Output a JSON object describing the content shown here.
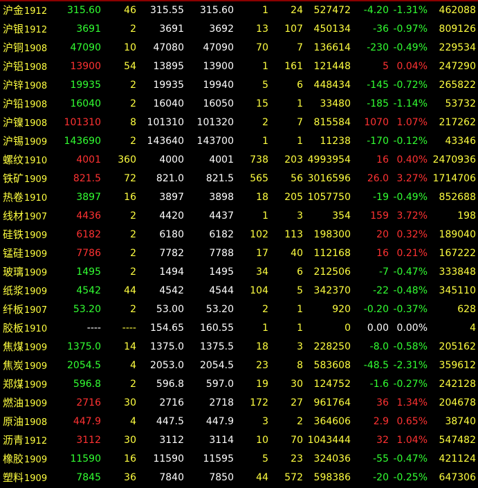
{
  "quotes": [
    {
      "name": "沪金",
      "code": "1912",
      "last": "315.60",
      "last_vol": "46",
      "bid": "315.55",
      "ask": "315.60",
      "bid_vol": "1",
      "ask_vol": "24",
      "volume": "527472",
      "change": "-4.20",
      "pct": "-1.31%",
      "open_interest": "462088",
      "dir": "down"
    },
    {
      "name": "沪银",
      "code": "1912",
      "last": "3691",
      "last_vol": "2",
      "bid": "3691",
      "ask": "3692",
      "bid_vol": "13",
      "ask_vol": "107",
      "volume": "450134",
      "change": "-36",
      "pct": "-0.97%",
      "open_interest": "809126",
      "dir": "down"
    },
    {
      "name": "沪铜",
      "code": "1908",
      "last": "47090",
      "last_vol": "10",
      "bid": "47080",
      "ask": "47090",
      "bid_vol": "70",
      "ask_vol": "7",
      "volume": "136614",
      "change": "-230",
      "pct": "-0.49%",
      "open_interest": "229534",
      "dir": "down"
    },
    {
      "name": "沪铝",
      "code": "1908",
      "last": "13900",
      "last_vol": "54",
      "bid": "13895",
      "ask": "13900",
      "bid_vol": "1",
      "ask_vol": "161",
      "volume": "121448",
      "change": "5",
      "pct": "0.04%",
      "open_interest": "247290",
      "dir": "up"
    },
    {
      "name": "沪锌",
      "code": "1908",
      "last": "19935",
      "last_vol": "2",
      "bid": "19935",
      "ask": "19940",
      "bid_vol": "5",
      "ask_vol": "6",
      "volume": "448434",
      "change": "-145",
      "pct": "-0.72%",
      "open_interest": "265822",
      "dir": "down"
    },
    {
      "name": "沪铅",
      "code": "1908",
      "last": "16040",
      "last_vol": "2",
      "bid": "16040",
      "ask": "16050",
      "bid_vol": "15",
      "ask_vol": "1",
      "volume": "33480",
      "change": "-185",
      "pct": "-1.14%",
      "open_interest": "53732",
      "dir": "down"
    },
    {
      "name": "沪镍",
      "code": "1908",
      "last": "101310",
      "last_vol": "8",
      "bid": "101310",
      "ask": "101320",
      "bid_vol": "2",
      "ask_vol": "7",
      "volume": "815584",
      "change": "1070",
      "pct": "1.07%",
      "open_interest": "217262",
      "dir": "up"
    },
    {
      "name": "沪锡",
      "code": "1909",
      "last": "143690",
      "last_vol": "2",
      "bid": "143640",
      "ask": "143700",
      "bid_vol": "1",
      "ask_vol": "1",
      "volume": "11238",
      "change": "-170",
      "pct": "-0.12%",
      "open_interest": "43346",
      "dir": "down"
    },
    {
      "name": "螺纹",
      "code": "1910",
      "last": "4001",
      "last_vol": "360",
      "bid": "4000",
      "ask": "4001",
      "bid_vol": "738",
      "ask_vol": "203",
      "volume": "4993954",
      "change": "16",
      "pct": "0.40%",
      "open_interest": "2470936",
      "dir": "up"
    },
    {
      "name": "铁矿",
      "code": "1909",
      "last": "821.5",
      "last_vol": "72",
      "bid": "821.0",
      "ask": "821.5",
      "bid_vol": "565",
      "ask_vol": "56",
      "volume": "3016596",
      "change": "26.0",
      "pct": "3.27%",
      "open_interest": "1714706",
      "dir": "up"
    },
    {
      "name": "热卷",
      "code": "1910",
      "last": "3897",
      "last_vol": "16",
      "bid": "3897",
      "ask": "3898",
      "bid_vol": "18",
      "ask_vol": "205",
      "volume": "1057750",
      "change": "-19",
      "pct": "-0.49%",
      "open_interest": "852688",
      "dir": "down"
    },
    {
      "name": "线材",
      "code": "1907",
      "last": "4436",
      "last_vol": "2",
      "bid": "4420",
      "ask": "4437",
      "bid_vol": "1",
      "ask_vol": "3",
      "volume": "354",
      "change": "159",
      "pct": "3.72%",
      "open_interest": "198",
      "dir": "up"
    },
    {
      "name": "硅铁",
      "code": "1909",
      "last": "6182",
      "last_vol": "2",
      "bid": "6180",
      "ask": "6182",
      "bid_vol": "102",
      "ask_vol": "113",
      "volume": "198300",
      "change": "20",
      "pct": "0.32%",
      "open_interest": "189040",
      "dir": "up"
    },
    {
      "name": "锰硅",
      "code": "1909",
      "last": "7786",
      "last_vol": "2",
      "bid": "7782",
      "ask": "7788",
      "bid_vol": "17",
      "ask_vol": "40",
      "volume": "112168",
      "change": "16",
      "pct": "0.21%",
      "open_interest": "167222",
      "dir": "up"
    },
    {
      "name": "玻璃",
      "code": "1909",
      "last": "1495",
      "last_vol": "2",
      "bid": "1494",
      "ask": "1495",
      "bid_vol": "34",
      "ask_vol": "6",
      "volume": "212506",
      "change": "-7",
      "pct": "-0.47%",
      "open_interest": "333848",
      "dir": "down"
    },
    {
      "name": "纸浆",
      "code": "1909",
      "last": "4542",
      "last_vol": "44",
      "bid": "4542",
      "ask": "4544",
      "bid_vol": "104",
      "ask_vol": "5",
      "volume": "342370",
      "change": "-22",
      "pct": "-0.48%",
      "open_interest": "345110",
      "dir": "down"
    },
    {
      "name": "纤板",
      "code": "1907",
      "last": "53.20",
      "last_vol": "2",
      "bid": "53.00",
      "ask": "53.20",
      "bid_vol": "2",
      "ask_vol": "1",
      "volume": "920",
      "change": "-0.20",
      "pct": "-0.37%",
      "open_interest": "628",
      "dir": "down"
    },
    {
      "name": "胶板",
      "code": "1910",
      "last": "----",
      "last_vol": "----",
      "bid": "154.65",
      "ask": "160.55",
      "bid_vol": "1",
      "ask_vol": "1",
      "volume": "0",
      "change": "0.00",
      "pct": "0.00%",
      "open_interest": "4",
      "dir": "flat"
    },
    {
      "name": "焦煤",
      "code": "1909",
      "last": "1375.0",
      "last_vol": "14",
      "bid": "1375.0",
      "ask": "1375.5",
      "bid_vol": "18",
      "ask_vol": "3",
      "volume": "228250",
      "change": "-8.0",
      "pct": "-0.58%",
      "open_interest": "205162",
      "dir": "down"
    },
    {
      "name": "焦炭",
      "code": "1909",
      "last": "2054.5",
      "last_vol": "4",
      "bid": "2053.0",
      "ask": "2054.5",
      "bid_vol": "23",
      "ask_vol": "8",
      "volume": "583608",
      "change": "-48.5",
      "pct": "-2.31%",
      "open_interest": "359612",
      "dir": "down"
    },
    {
      "name": "郑煤",
      "code": "1909",
      "last": "596.8",
      "last_vol": "2",
      "bid": "596.8",
      "ask": "597.0",
      "bid_vol": "19",
      "ask_vol": "30",
      "volume": "124752",
      "change": "-1.6",
      "pct": "-0.27%",
      "open_interest": "242128",
      "dir": "down"
    },
    {
      "name": "燃油",
      "code": "1909",
      "last": "2716",
      "last_vol": "30",
      "bid": "2716",
      "ask": "2718",
      "bid_vol": "172",
      "ask_vol": "27",
      "volume": "961764",
      "change": "36",
      "pct": "1.34%",
      "open_interest": "204678",
      "dir": "up"
    },
    {
      "name": "原油",
      "code": "1908",
      "last": "447.9",
      "last_vol": "4",
      "bid": "447.5",
      "ask": "447.9",
      "bid_vol": "3",
      "ask_vol": "2",
      "volume": "364606",
      "change": "2.9",
      "pct": "0.65%",
      "open_interest": "38740",
      "dir": "up"
    },
    {
      "name": "沥青",
      "code": "1912",
      "last": "3112",
      "last_vol": "30",
      "bid": "3112",
      "ask": "3114",
      "bid_vol": "10",
      "ask_vol": "70",
      "volume": "1043444",
      "change": "32",
      "pct": "1.04%",
      "open_interest": "547482",
      "dir": "up"
    },
    {
      "name": "橡胶",
      "code": "1909",
      "last": "11590",
      "last_vol": "16",
      "bid": "11590",
      "ask": "11595",
      "bid_vol": "5",
      "ask_vol": "23",
      "volume": "324036",
      "change": "-55",
      "pct": "-0.47%",
      "open_interest": "421124",
      "dir": "down"
    },
    {
      "name": "塑料",
      "code": "1909",
      "last": "7845",
      "last_vol": "36",
      "bid": "7840",
      "ask": "7850",
      "bid_vol": "44",
      "ask_vol": "572",
      "volume": "598386",
      "change": "-20",
      "pct": "-0.25%",
      "open_interest": "647306",
      "dir": "down"
    }
  ],
  "colors": {
    "background": "#000000",
    "up": "#ff3232",
    "down": "#32ff32",
    "flat": "#ffffff",
    "label": "#ffff40",
    "price": "#ffffff"
  }
}
